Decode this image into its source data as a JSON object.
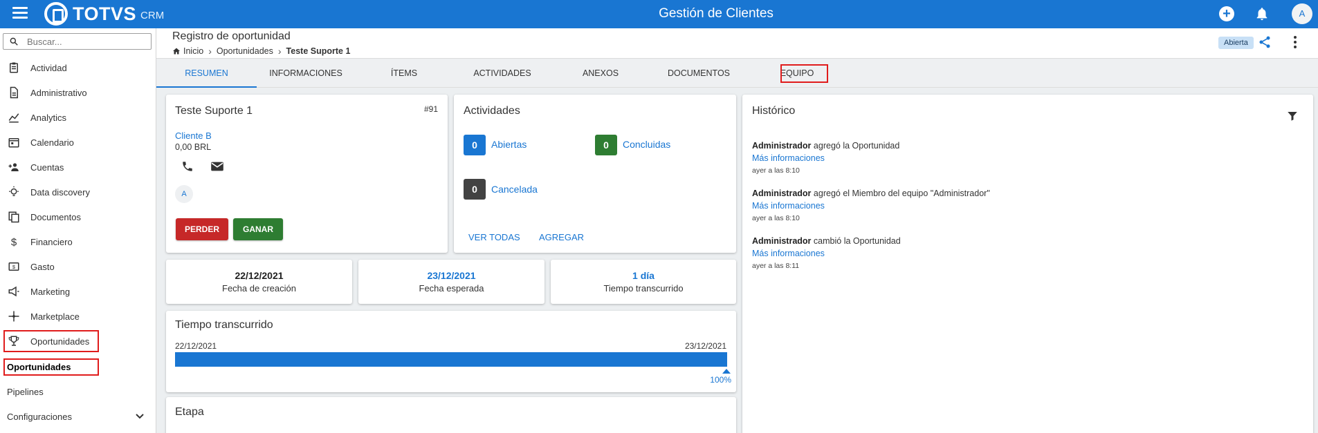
{
  "app": {
    "brand": "TOTVS",
    "brand_suffix": "CRM",
    "title": "Gestión de Clientes",
    "user_initial": "A"
  },
  "search": {
    "placeholder": "Buscar..."
  },
  "sidebar": {
    "items": [
      {
        "label": "Actividad",
        "icon": "clipboard-icon"
      },
      {
        "label": "Administrativo",
        "icon": "document-icon"
      },
      {
        "label": "Analytics",
        "icon": "chart-icon"
      },
      {
        "label": "Calendario",
        "icon": "calendar-icon"
      },
      {
        "label": "Cuentas",
        "icon": "people-icon"
      },
      {
        "label": "Data discovery",
        "icon": "lightbulb-icon"
      },
      {
        "label": "Documentos",
        "icon": "documents-icon"
      },
      {
        "label": "Financiero",
        "icon": "dollar-icon"
      },
      {
        "label": "Gasto",
        "icon": "receipt-icon"
      },
      {
        "label": "Marketing",
        "icon": "megaphone-icon"
      },
      {
        "label": "Marketplace",
        "icon": "move-icon"
      },
      {
        "label": "Oportunidades",
        "icon": "trophy-icon"
      }
    ],
    "sub_items": [
      {
        "label": "Oportunidades"
      },
      {
        "label": "Pipelines"
      },
      {
        "label": "Configuraciones"
      }
    ]
  },
  "header": {
    "page_title": "Registro de oportunidad",
    "breadcrumb": [
      "Inicio",
      "Oportunidades",
      "Teste Suporte 1"
    ],
    "status": "Abierta"
  },
  "tabs": [
    {
      "label": "Resumen"
    },
    {
      "label": "Informaciones"
    },
    {
      "label": "Ítems"
    },
    {
      "label": "Actividades"
    },
    {
      "label": "Anexos"
    },
    {
      "label": "Documentos"
    },
    {
      "label": "Equipo"
    }
  ],
  "opportunity": {
    "name": "Teste Suporte 1",
    "number": "#91",
    "client": "Cliente B",
    "amount": "0,00 BRL",
    "owner_initial": "A",
    "lose_label": "PERDER",
    "win_label": "GANAR"
  },
  "activities": {
    "title": "Actividades",
    "open_count": "0",
    "open_label": "Abiertas",
    "done_count": "0",
    "done_label": "Concluidas",
    "cancelled_count": "0",
    "cancelled_label": "Cancelada",
    "view_all": "Ver todas",
    "add": "Agregar"
  },
  "dates": [
    {
      "value": "22/12/2021",
      "label": "Fecha de creación"
    },
    {
      "value": "23/12/2021",
      "label": "Fecha esperada"
    },
    {
      "value": "1 día",
      "label": "Tiempo transcurrido"
    }
  ],
  "elapsed": {
    "title": "Tiempo transcurrido",
    "start": "22/12/2021",
    "end": "23/12/2021",
    "progress": 100,
    "progress_label": "100%"
  },
  "stage": {
    "title": "Etapa"
  },
  "history": {
    "title": "Histórico",
    "entries": [
      {
        "actor": "Administrador",
        "action": "agregó la Oportunidad",
        "more": "Más informaciones",
        "time": "ayer a las 8:10"
      },
      {
        "actor": "Administrador",
        "action": "agregó el Miembro del equipo \"Administrador\"",
        "more": "Más informaciones",
        "time": "ayer a las 8:10"
      },
      {
        "actor": "Administrador",
        "action": "cambió la Oportunidad",
        "more": "Más informaciones",
        "time": "ayer a las 8:11"
      }
    ]
  },
  "colors": {
    "primary": "#1976d2",
    "lose": "#c62828",
    "win": "#2e7d32",
    "open_badge": "#1976d2",
    "done_badge": "#2e7d32",
    "cancelled_badge": "#424242",
    "highlight": "#e01b1b"
  }
}
